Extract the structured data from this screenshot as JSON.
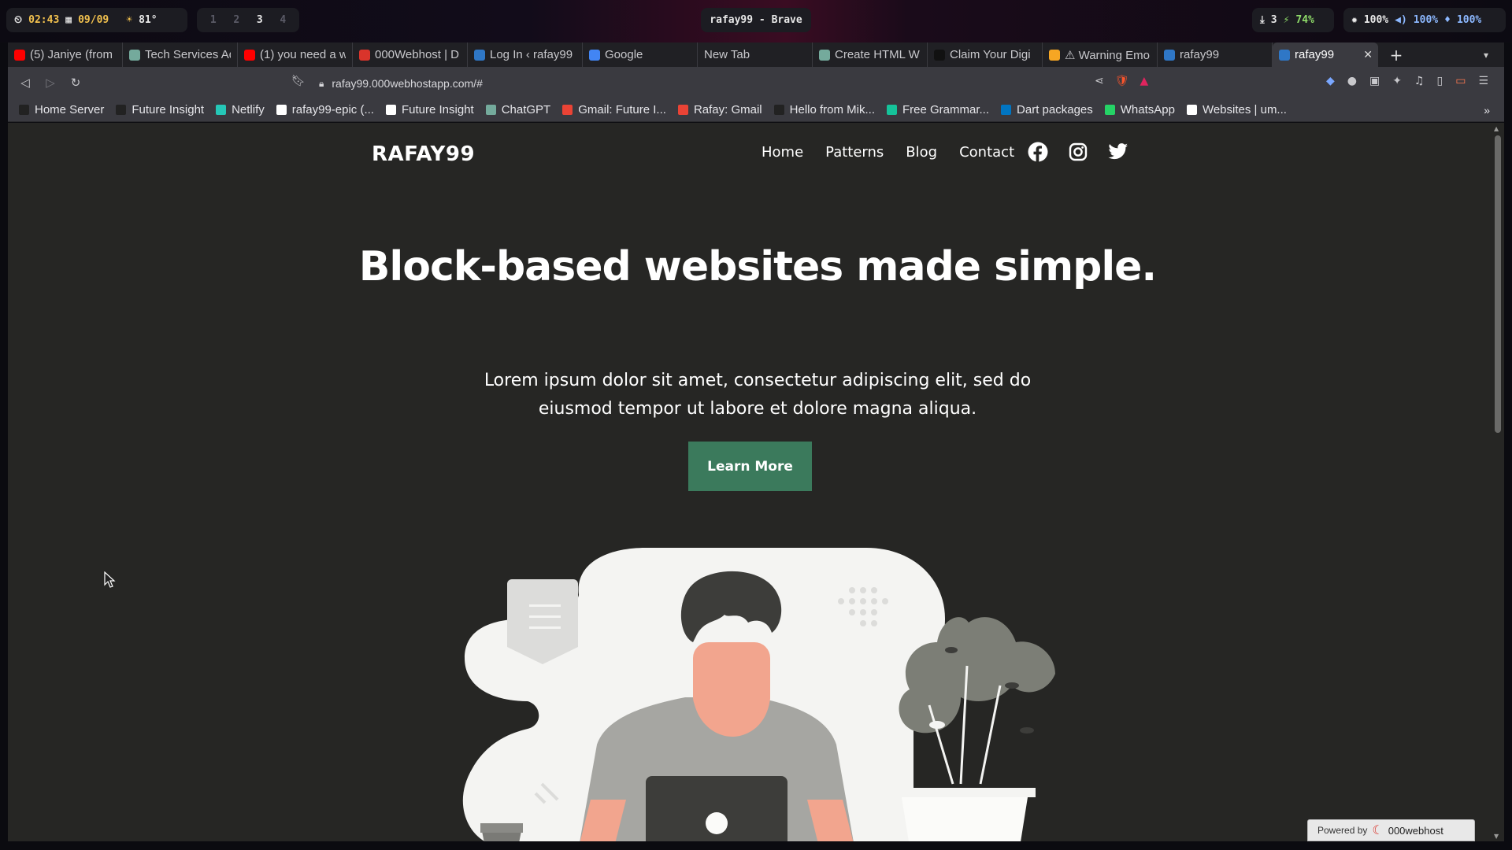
{
  "system_bar": {
    "time": "02:43",
    "date": "09/09",
    "temperature": "81°",
    "workspaces": [
      "1",
      "2",
      "3",
      "4"
    ],
    "active_workspace": "3",
    "window_title": "rafay99 - Brave",
    "downloads": "3",
    "battery": "74%",
    "brightness": "100%",
    "volume": "100%",
    "mic": "100%"
  },
  "tabs": [
    {
      "label": "(5) Janiye (from",
      "icon": "youtube-icon",
      "color": "#ff0000"
    },
    {
      "label": "Tech Services Ad",
      "icon": "chatgpt-icon",
      "color": "#74aa9c"
    },
    {
      "label": "(1) you need a w",
      "icon": "youtube-icon",
      "color": "#ff0000"
    },
    {
      "label": "000Webhost | D",
      "icon": "webhost-icon",
      "color": "#d9342b"
    },
    {
      "label": "Log In ‹ rafay99",
      "icon": "wordpress-icon",
      "color": "#2f77c6"
    },
    {
      "label": "Google",
      "icon": "google-icon",
      "color": "#4285f4"
    },
    {
      "label": "New Tab",
      "icon": "",
      "color": ""
    },
    {
      "label": "Create HTML W",
      "icon": "chatgpt-icon",
      "color": "#74aa9c"
    },
    {
      "label": "Claim Your Digi",
      "icon": "site-icon",
      "color": "#111111"
    },
    {
      "label": "⚠ Warning Emo",
      "icon": "bookmark-icon",
      "color": "#f6a623"
    },
    {
      "label": "rafay99",
      "icon": "wordpress-icon",
      "color": "#2f77c6"
    },
    {
      "label": "rafay99",
      "icon": "wordpress-icon",
      "color": "#2f77c6"
    }
  ],
  "url": "rafay99.000webhostapp.com/#",
  "bookmarks": [
    {
      "label": "Home Server",
      "color": "#222222"
    },
    {
      "label": "Future Insight",
      "color": "#222222"
    },
    {
      "label": "Netlify",
      "color": "#25c7b7"
    },
    {
      "label": "rafay99-epic (...",
      "color": "#ffffff"
    },
    {
      "label": "Future Insight",
      "color": "#ffffff"
    },
    {
      "label": "ChatGPT",
      "color": "#74aa9c"
    },
    {
      "label": "Gmail: Future I...",
      "color": "#ea4335"
    },
    {
      "label": "Rafay: Gmail",
      "color": "#ea4335"
    },
    {
      "label": "Hello from Mik...",
      "color": "#222222"
    },
    {
      "label": "Free Grammar...",
      "color": "#15c39a"
    },
    {
      "label": "Dart packages",
      "color": "#0175c2"
    },
    {
      "label": "WhatsApp",
      "color": "#25d366"
    },
    {
      "label": "Websites | um...",
      "color": "#ffffff"
    }
  ],
  "site": {
    "title": "RAFAY99",
    "nav": [
      "Home",
      "Patterns",
      "Blog",
      "Contact"
    ],
    "hero_title": "Block-based websites made simple.",
    "hero_subtitle": "Lorem ipsum dolor sit amet, consectetur adipiscing elit, sed do eiusmod tempor ut labore et dolore magna aliqua.",
    "cta_label": "Learn More",
    "powered_by_label": "Powered by",
    "powered_by_brand": "000webhost"
  },
  "colors": {
    "page_bg": "#262624",
    "cta_bg": "#3b7a5c",
    "browser_chrome": "#3a3a40"
  }
}
